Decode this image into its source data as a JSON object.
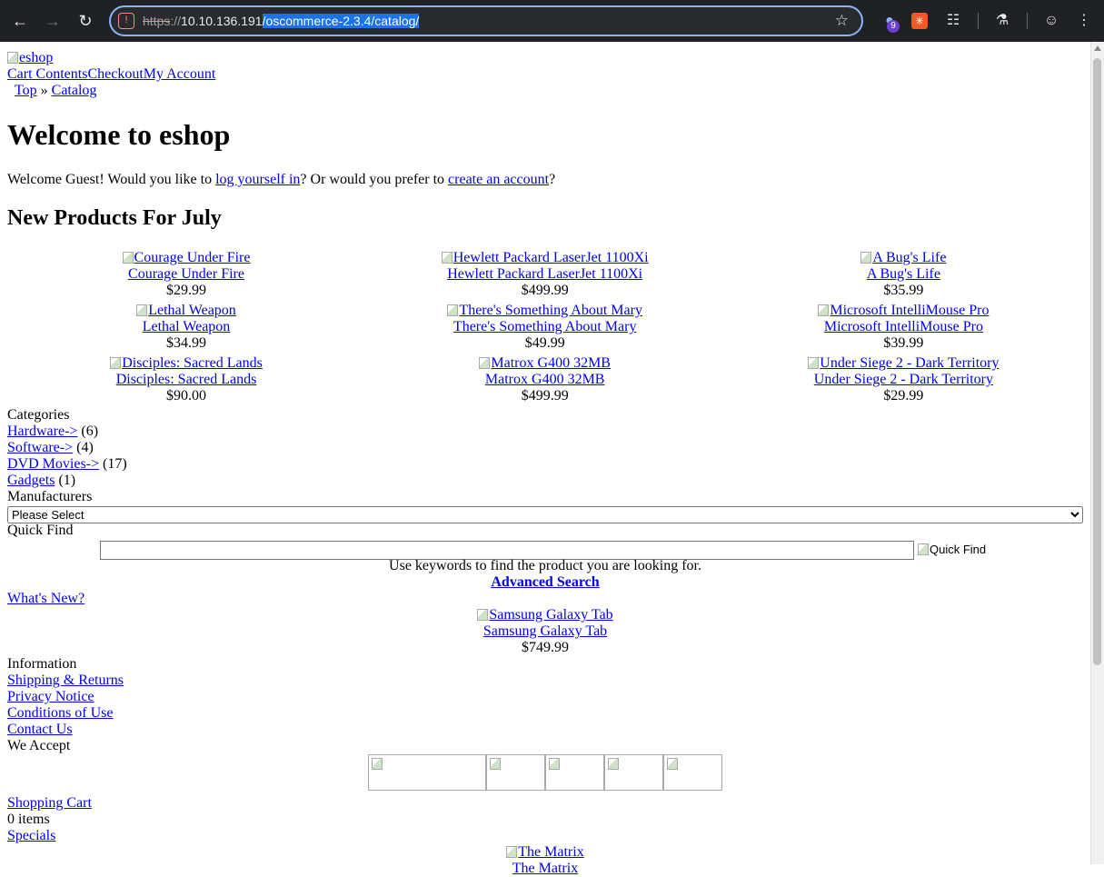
{
  "browser": {
    "url_scheme": "https",
    "url_sep": "://",
    "url_host": "10.10.136.191",
    "url_path": "/oscommerce-2.3.4/catalog/",
    "ext_badge": "9"
  },
  "header": {
    "logo_alt": "eshop",
    "links": [
      "Cart Contents",
      "Checkout",
      "My Account"
    ],
    "breadcrumb": [
      "Top",
      "»",
      "Catalog"
    ]
  },
  "welcome": {
    "title": "Welcome to eshop",
    "text1": "Welcome Guest! Would you like to ",
    "login_link": "log yourself in",
    "text2": "? Or would you prefer to ",
    "create_link": "create an account",
    "text3": "?"
  },
  "new_products": {
    "heading": "New Products For July",
    "items": [
      {
        "name": "Courage Under Fire",
        "price": "$29.99"
      },
      {
        "name": "Hewlett Packard LaserJet 1100Xi",
        "price": "$499.99"
      },
      {
        "name": "A Bug's Life",
        "price": "$35.99"
      },
      {
        "name": "Lethal Weapon",
        "price": "$34.99"
      },
      {
        "name": "There's Something About Mary",
        "price": "$49.99"
      },
      {
        "name": "Microsoft IntelliMouse Pro",
        "price": "$39.99"
      },
      {
        "name": "Disciples: Sacred Lands",
        "price": "$90.00"
      },
      {
        "name": "Matrox G400 32MB",
        "price": "$499.99"
      },
      {
        "name": "Under Siege 2 - Dark Territory",
        "price": "$29.99"
      }
    ]
  },
  "categories": {
    "heading": "Categories",
    "items": [
      {
        "label": "Hardware->",
        "count": "(6)"
      },
      {
        "label": "Software->",
        "count": "(4)"
      },
      {
        "label": "DVD Movies->",
        "count": "(17)"
      },
      {
        "label": "Gadgets",
        "count": "(1)"
      }
    ]
  },
  "manufacturers": {
    "heading": "Manufacturers",
    "selected": "Please Select"
  },
  "quick_find": {
    "heading": "Quick Find",
    "button_alt": "Quick Find",
    "hint": "Use keywords to find the product you are looking for.",
    "advanced": "Advanced Search"
  },
  "whats_new": {
    "link": "What's New?",
    "product": "Samsung Galaxy Tab",
    "price": "$749.99"
  },
  "information": {
    "heading": "Information",
    "links": [
      "Shipping & Returns",
      "Privacy Notice",
      "Conditions of Use",
      "Contact Us"
    ]
  },
  "we_accept": {
    "heading": "We Accept"
  },
  "shopping_cart": {
    "link": "Shopping Cart",
    "items": "0 items"
  },
  "specials": {
    "link": "Specials",
    "product": "The Matrix"
  }
}
